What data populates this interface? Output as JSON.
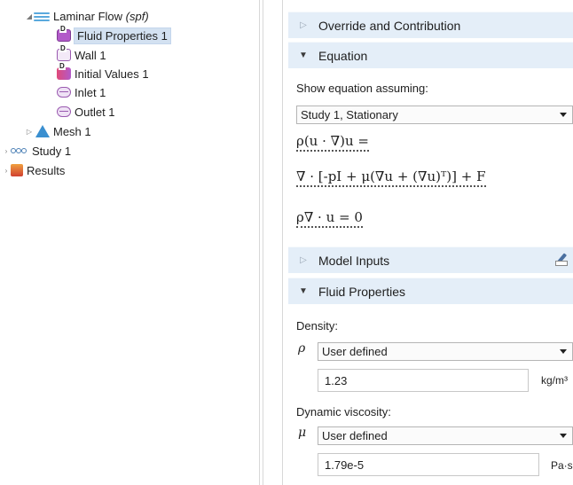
{
  "tree": {
    "laminar_flow": {
      "label": "Laminar Flow",
      "tag": "(spf)"
    },
    "items": [
      {
        "label": "Fluid Properties 1",
        "icon": "fluid-properties-icon"
      },
      {
        "label": "Wall 1",
        "icon": "wall-icon"
      },
      {
        "label": "Initial Values 1",
        "icon": "initial-values-icon"
      },
      {
        "label": "Inlet 1",
        "icon": "boundary-icon"
      },
      {
        "label": "Outlet 1",
        "icon": "boundary-icon"
      }
    ],
    "mesh": {
      "label": "Mesh 1"
    },
    "study": {
      "label": "Study 1"
    },
    "results": {
      "label": "Results"
    }
  },
  "panel": {
    "override_section": "Override and Contribution",
    "equation_section": "Equation",
    "show_equation_label": "Show equation assuming:",
    "study_select": "Study 1, Stationary",
    "equations": {
      "line1": "ρ(u · ∇)u =",
      "line2": "∇ · [-pI + μ(∇u + (∇u)ᵀ)] + F",
      "line3": "ρ∇ · u = 0"
    },
    "model_inputs_section": "Model Inputs",
    "fluid_properties_section": "Fluid Properties",
    "density_label": "Density:",
    "density_symbol": "ρ",
    "density_select": "User defined",
    "density_value": "1.23",
    "density_unit": "kg/m³",
    "viscosity_label": "Dynamic viscosity:",
    "viscosity_symbol": "μ",
    "viscosity_select": "User defined",
    "viscosity_value": "1.79e-5",
    "viscosity_unit": "Pa·s"
  },
  "colors": {
    "section_header": "#e4eef8",
    "selection": "#d3e1f1",
    "physics_purple": "#b25ac9"
  }
}
